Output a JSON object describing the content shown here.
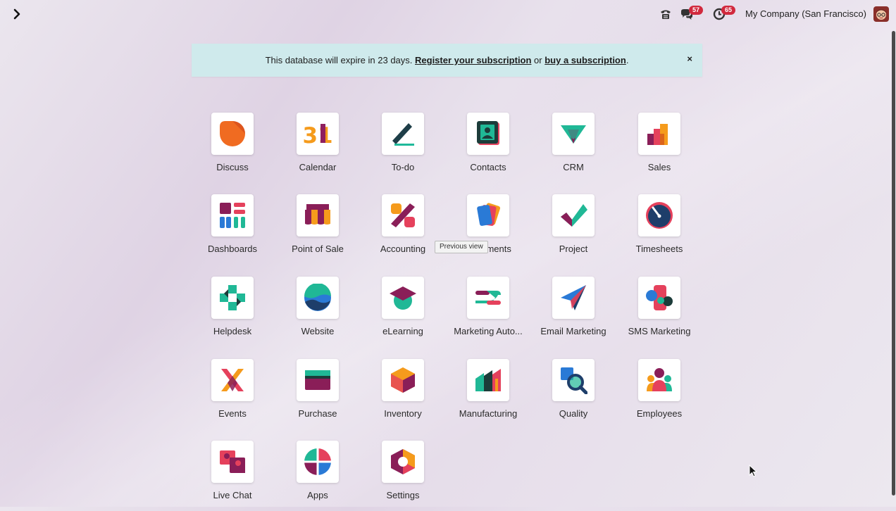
{
  "topbar": {
    "menu_icon": "chevron-right-icon",
    "messages_count": "57",
    "activities_count": "65",
    "company": "My Company (San Francisco)"
  },
  "banner": {
    "text_before": "This database will expire in 23 days. ",
    "register_link": "Register your subscription",
    "text_middle": " or ",
    "buy_link": "buy a subscription",
    "text_after": ".",
    "close": "×"
  },
  "tooltip": "Previous view",
  "apps": [
    {
      "label": "Discuss"
    },
    {
      "label": "Calendar"
    },
    {
      "label": "To-do"
    },
    {
      "label": "Contacts"
    },
    {
      "label": "CRM"
    },
    {
      "label": "Sales"
    },
    {
      "label": "Dashboards"
    },
    {
      "label": "Point of Sale"
    },
    {
      "label": "Accounting"
    },
    {
      "label": "Documents"
    },
    {
      "label": "Project"
    },
    {
      "label": "Timesheets"
    },
    {
      "label": "Helpdesk"
    },
    {
      "label": "Website"
    },
    {
      "label": "eLearning"
    },
    {
      "label": "Marketing Auto..."
    },
    {
      "label": "Email Marketing"
    },
    {
      "label": "SMS Marketing"
    },
    {
      "label": "Events"
    },
    {
      "label": "Purchase"
    },
    {
      "label": "Inventory"
    },
    {
      "label": "Manufacturing"
    },
    {
      "label": "Quality"
    },
    {
      "label": "Employees"
    },
    {
      "label": "Live Chat"
    },
    {
      "label": "Apps"
    },
    {
      "label": "Settings"
    }
  ],
  "calendar_icon_text": "31"
}
